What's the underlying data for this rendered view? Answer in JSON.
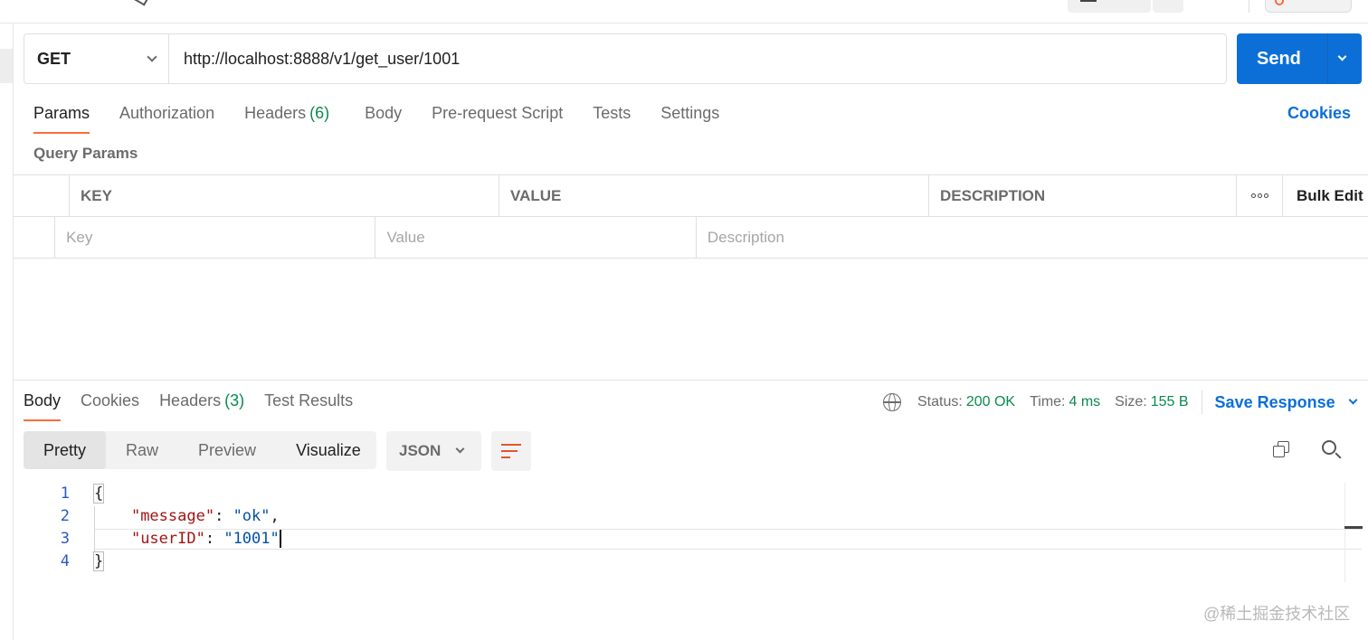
{
  "request": {
    "method": "GET",
    "url": "http://localhost:8888/v1/get_user/1001",
    "send_label": "Send"
  },
  "request_tabs": [
    {
      "label": "Params",
      "count": ""
    },
    {
      "label": "Authorization",
      "count": ""
    },
    {
      "label": "Headers",
      "count": "(6)"
    },
    {
      "label": "Body",
      "count": ""
    },
    {
      "label": "Pre-request Script",
      "count": ""
    },
    {
      "label": "Tests",
      "count": ""
    },
    {
      "label": "Settings",
      "count": ""
    }
  ],
  "cookies_link": "Cookies",
  "query_params": {
    "title": "Query Params",
    "headers": {
      "key": "KEY",
      "value": "VALUE",
      "description": "DESCRIPTION",
      "bulk_edit": "Bulk Edit"
    },
    "placeholders": {
      "key": "Key",
      "value": "Value",
      "description": "Description"
    }
  },
  "response_tabs": [
    {
      "label": "Body",
      "count": ""
    },
    {
      "label": "Cookies",
      "count": ""
    },
    {
      "label": "Headers",
      "count": "(3)"
    },
    {
      "label": "Test Results",
      "count": ""
    }
  ],
  "response_status": {
    "status_label": "Status:",
    "status_value": "200 OK",
    "time_label": "Time:",
    "time_value": "4 ms",
    "size_label": "Size:",
    "size_value": "155 B",
    "save_response": "Save Response"
  },
  "view_modes": [
    "Pretty",
    "Raw",
    "Preview",
    "Visualize"
  ],
  "format": "JSON",
  "code": {
    "line_numbers": [
      "1",
      "2",
      "3",
      "4"
    ],
    "open_brace": "{",
    "close_brace": "}",
    "message_key": "\"message\"",
    "message_value": "\"ok\"",
    "userid_key": "\"userID\"",
    "userid_value": "\"1001\""
  },
  "watermark": "@稀土掘金技术社区",
  "colors": {
    "accent": "#ff6c37",
    "primary": "#0c6fd8",
    "success": "#0a8a4d"
  }
}
